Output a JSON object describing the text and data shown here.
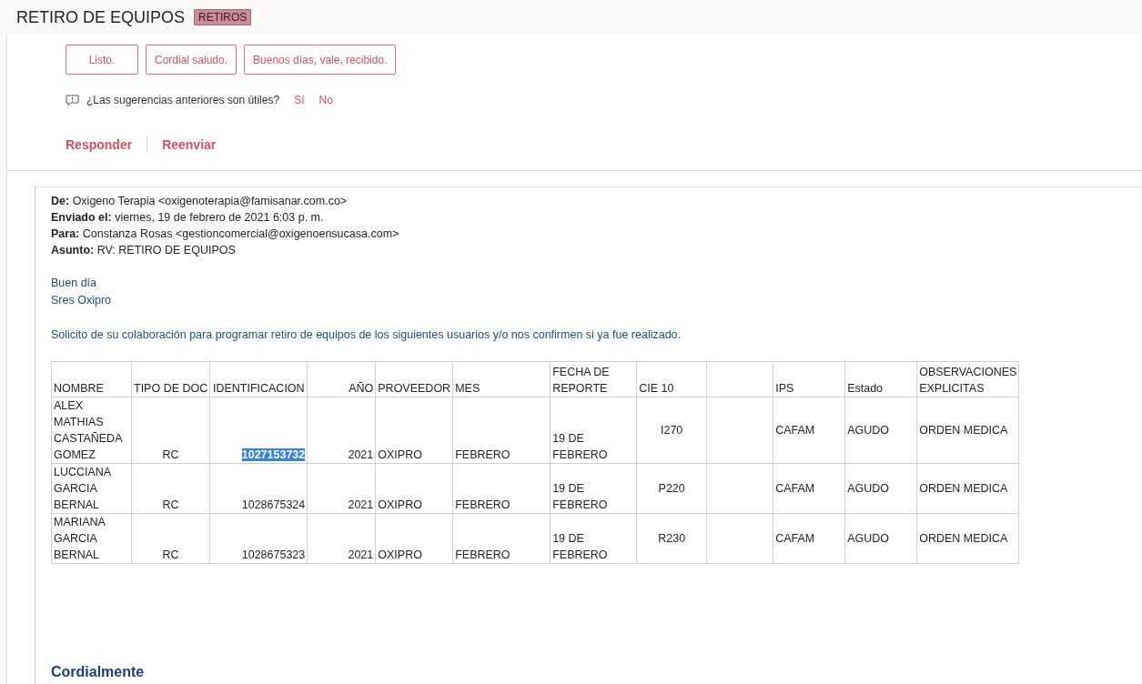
{
  "header": {
    "title": "RETIRO DE EQUIPOS",
    "tag": "RETIROS"
  },
  "suggestions": [
    "Listo.",
    "Cordial saludo.",
    "Buenos días, vale, recibido."
  ],
  "feedback": {
    "question": "¿Las sugerencias anteriores son útiles?",
    "yes": "Sí",
    "no": "No"
  },
  "actions": [
    "Responder",
    "Reenviar"
  ],
  "quoted": {
    "fields": [
      "**De:** Oxigeno Terapia <oxigenoterapia@famisanar.com.co>",
      "**Enviado el:** viernes, 19 de febrero de 2021 6:03 p. m.",
      "**Para:** Constanza Rosas <gestioncomercial@oxigenoensucasa.com>",
      "**Asunto:** RV: RETIRO DE EQUIPOS"
    ],
    "greeting": [
      "Buen día",
      "Sres Oxipro"
    ],
    "body": "Solicito de su colaboración para programar retiro de equipos de los siguientes usuarios y/o nos confirmen si ya fue realizado.",
    "table": {
      "columns": [
        {
          "kind": "text",
          "label": "NOMBRE"
        },
        {
          "kind": "text",
          "label": "TIPO DE DOC"
        },
        {
          "kind": "text",
          "label": "IDENTIFICACION"
        },
        {
          "kind": "text",
          "label": "AÑO"
        },
        {
          "kind": "text",
          "label": "PROVEEDOR"
        },
        {
          "kind": "text",
          "label": "MES"
        },
        {
          "kind": "text",
          "label": "FECHA DE REPORTE"
        },
        {
          "kind": "text",
          "label": "CIE 10"
        },
        {
          "kind": "blank"
        },
        {
          "kind": "text",
          "label": "IPS"
        },
        {
          "kind": "text",
          "label": "Estado"
        },
        {
          "kind": "text",
          "label": "OBSERVACIONES EXPLICITAS"
        }
      ],
      "rows": [
        {
          "id_selected": true,
          "cells": [
            "ALEX MATHIAS CASTAÑEDA GOMEZ",
            "RC",
            "1027153732",
            "2021",
            "OXIPRO",
            "FEBRERO",
            "19 DE FEBRERO",
            "I270",
            null,
            "CAFAM",
            "AGUDO",
            "ORDEN MEDICA"
          ]
        },
        {
          "id_selected": false,
          "cells": [
            "LUCCIANA GARCIA BERNAL",
            "RC",
            "1028675324",
            "2021",
            "OXIPRO",
            "FEBRERO",
            "19 DE FEBRERO",
            "P220",
            null,
            "CAFAM",
            "AGUDO",
            "ORDEN MEDICA"
          ]
        },
        {
          "id_selected": false,
          "cells": [
            "MARIANA GARCIA BERNAL",
            "RC",
            "1028675323",
            "2021",
            "OXIPRO",
            "FEBRERO",
            "19 DE FEBRERO",
            "R230",
            null,
            "CAFAM",
            "AGUDO",
            "ORDEN MEDICA"
          ]
        }
      ]
    },
    "closing": "Cordialmente"
  }
}
